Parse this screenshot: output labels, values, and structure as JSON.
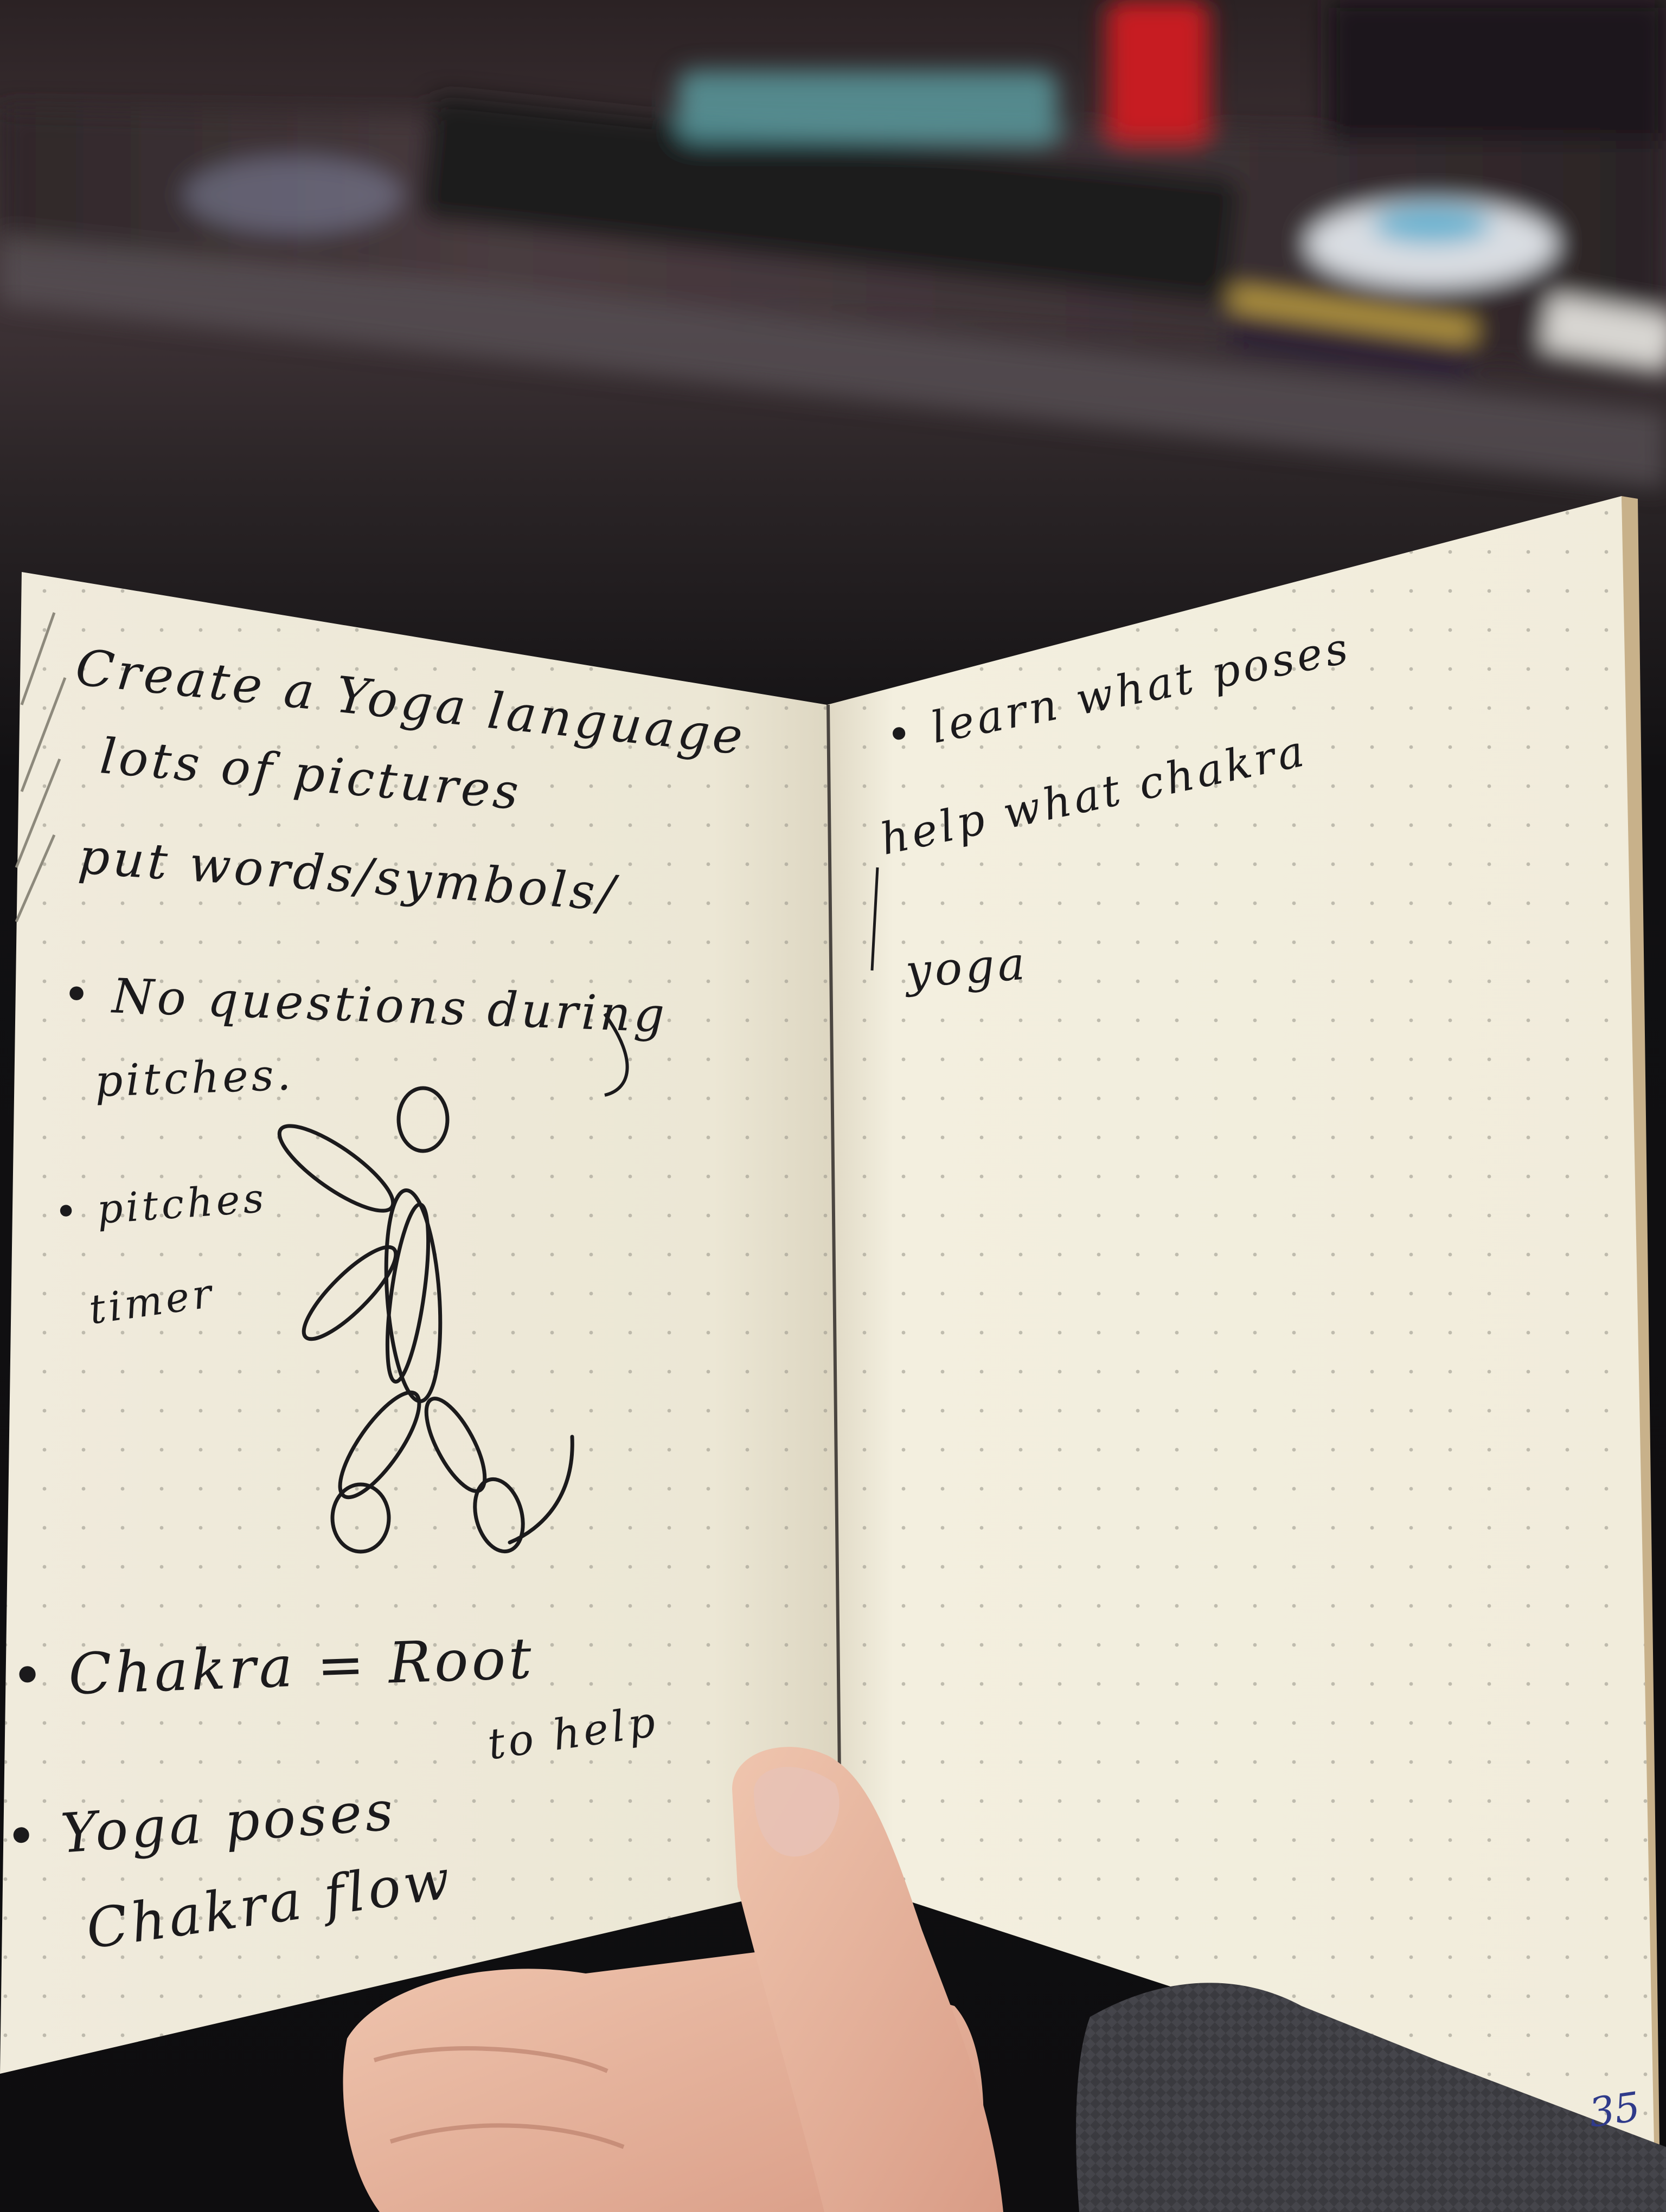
{
  "notebook": {
    "left_page": {
      "lines": [
        "Create a Yoga language",
        "lots of pictures",
        "put words/symbols/",
        "• No questions during",
        "pitches.",
        "• pitches",
        "timer",
        "• Chakra = Root",
        "to help",
        "• Yoga poses",
        "Chakra flow"
      ]
    },
    "right_page": {
      "lines": [
        "• learn what poses",
        "help what chakra",
        "yoga"
      ],
      "page_number": "35"
    }
  },
  "colors": {
    "paper": "#f3efdf",
    "ink": "#1b1a1c",
    "page_number_ink": "#2f3a8a",
    "table": "#3a3033",
    "skin": "#e7b8a2",
    "sleeve": "#3b3b3f"
  }
}
